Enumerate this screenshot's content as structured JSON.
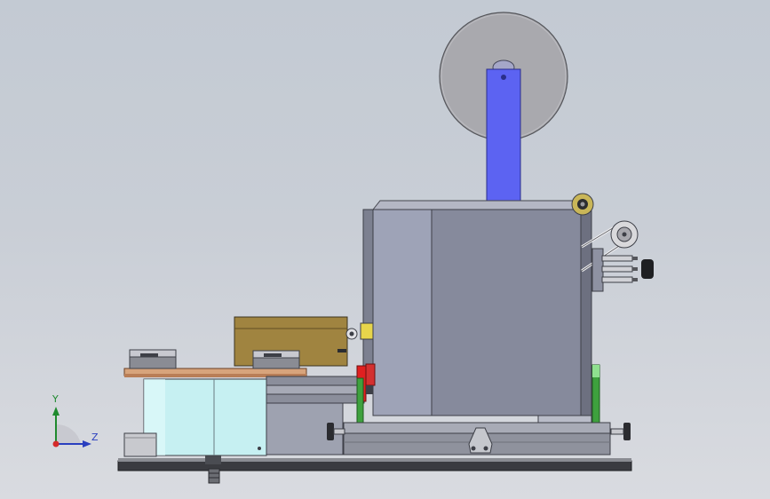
{
  "view": {
    "title": "",
    "background_top": "#c3cad3",
    "background_bottom": "#d9dbe0"
  },
  "triad": {
    "y_label": "Y",
    "z_label": "Z",
    "y_color": "#1f8a2e",
    "z_color": "#2a3fbf",
    "origin_color": "#d42a2a"
  },
  "model": {
    "name": "",
    "arm_color": "#5c63f2",
    "cabinet_color": "#868a9c",
    "side_panel_color": "#9ea3b7",
    "reel_color": "#a9a9ae",
    "cylinder_color": "#c6f0f2",
    "box_color": "#a08440",
    "guide_color": "#3ea13e"
  }
}
